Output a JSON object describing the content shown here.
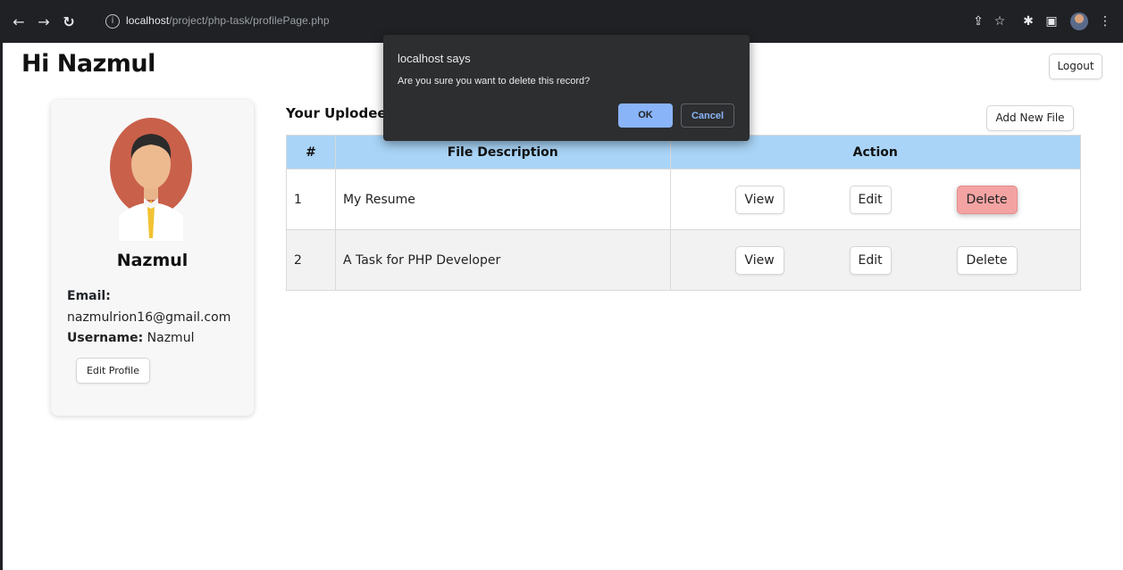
{
  "browser": {
    "url_host": "localhost",
    "url_path": "/project/php-task/profilePage.php"
  },
  "page": {
    "greeting": "Hi Nazmul",
    "logout_label": "Logout"
  },
  "profile": {
    "name": "Nazmul",
    "email_label": "Email:",
    "email": "nazmulrion16@gmail.com",
    "username_label": "Username:",
    "username": "Nazmul",
    "edit_profile_label": "Edit Profile"
  },
  "files": {
    "section_title": "Your Uplodee",
    "add_new_label": "Add New File",
    "headers": [
      "#",
      "File Description",
      "Action"
    ],
    "rows": [
      {
        "num": "1",
        "description": "My Resume",
        "view": "View",
        "edit": "Edit",
        "delete": "Delete"
      },
      {
        "num": "2",
        "description": "A Task for PHP Developer",
        "view": "View",
        "edit": "Edit",
        "delete": "Delete"
      }
    ]
  },
  "dialog": {
    "title": "localhost says",
    "message": "Are you sure you want to delete this record?",
    "ok_label": "OK",
    "cancel_label": "Cancel"
  },
  "colors": {
    "header_bg": "#a9d4f7",
    "delete_active": "#f4a3a3",
    "dialog_bg": "#2d2e30",
    "dialog_accent": "#8ab4f8"
  }
}
